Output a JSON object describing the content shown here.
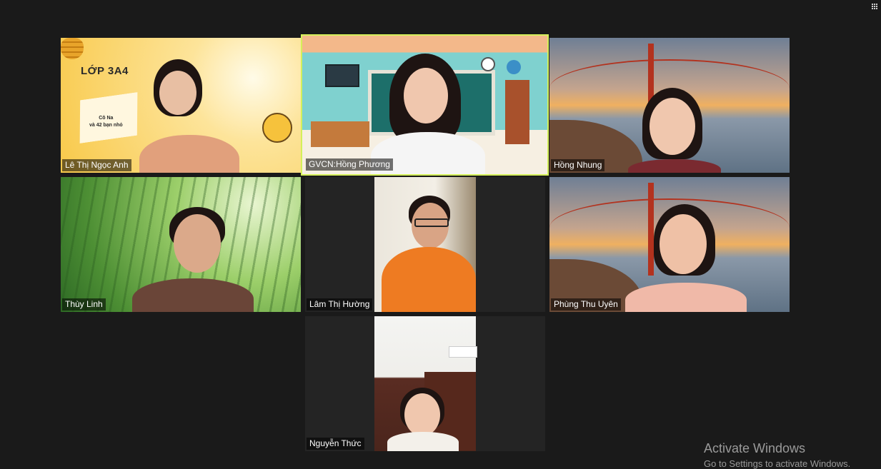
{
  "meeting": {
    "participants": [
      {
        "name": "Lê Thị Ngọc Anh",
        "active": false
      },
      {
        "name": "GVCN:Hồng Phương",
        "active": true
      },
      {
        "name": "Hồng Nhung",
        "active": false
      },
      {
        "name": "Thùy Linh",
        "active": false
      },
      {
        "name": "Lâm Thị Hường",
        "active": false
      },
      {
        "name": "Phùng Thu Uyên",
        "active": false
      },
      {
        "name": "Nguyễn Thức",
        "active": false
      }
    ],
    "background_slide": {
      "title": "LỚP 3A4",
      "line1": "Cô Na",
      "line2": "và 42 bạn nhỏ"
    },
    "active_speaker_color": "#d4f05a"
  },
  "toolbar": {
    "view_icon": "grid-view-icon"
  },
  "watermark": {
    "title": "Activate Windows",
    "subtitle": "Go to Settings to activate Windows."
  }
}
